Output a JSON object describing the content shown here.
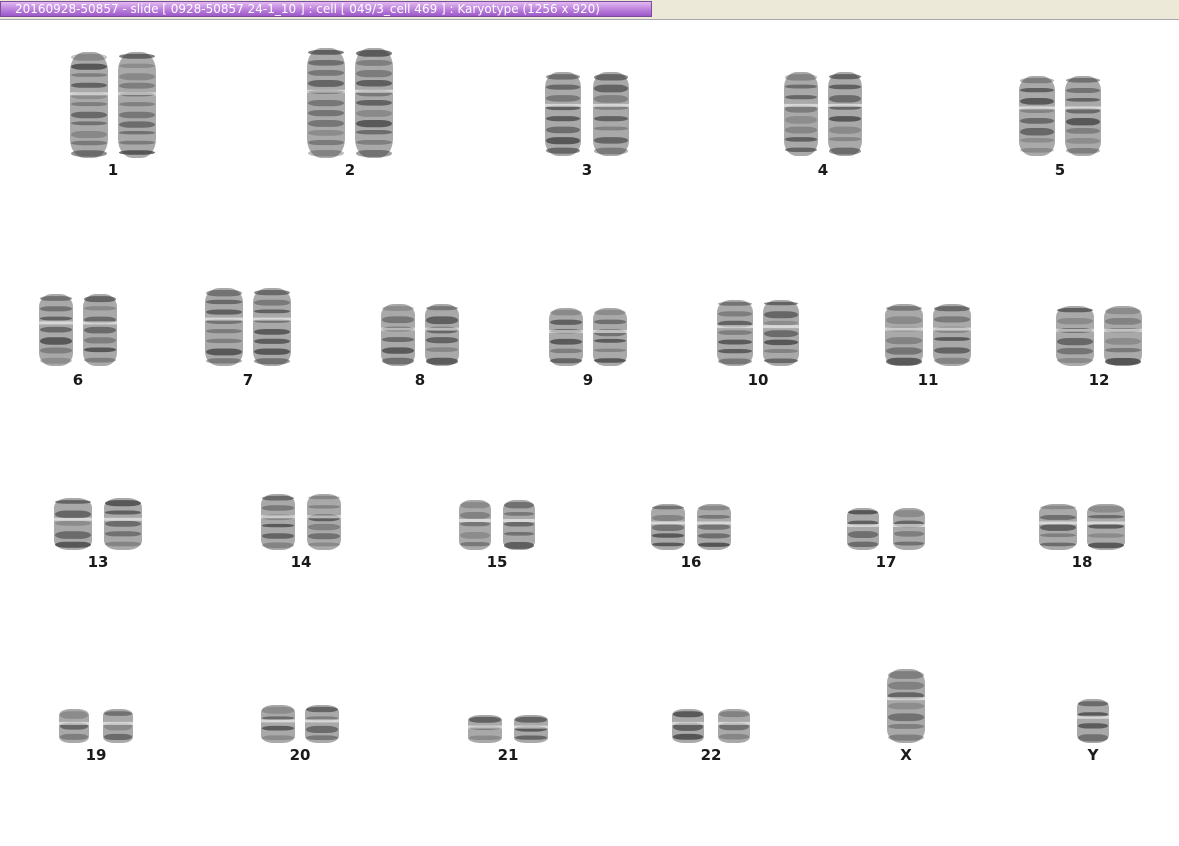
{
  "window": {
    "title": "20160928-50857 - slide [ 0928-50857 24-1_10 ] : cell [ 049/3_cell 469 ] : Karyotype  (1256 x 920)"
  },
  "karyotype": {
    "ink": "#3a3a3a",
    "rows": [
      [
        {
          "label": "1",
          "count": 2
        },
        {
          "label": "2",
          "count": 2
        },
        {
          "label": "3",
          "count": 2
        },
        {
          "label": "4",
          "count": 2
        },
        {
          "label": "5",
          "count": 2
        }
      ],
      [
        {
          "label": "6",
          "count": 2
        },
        {
          "label": "7",
          "count": 2
        },
        {
          "label": "8",
          "count": 2
        },
        {
          "label": "9",
          "count": 2
        },
        {
          "label": "10",
          "count": 2
        },
        {
          "label": "11",
          "count": 2
        },
        {
          "label": "12",
          "count": 2
        }
      ],
      [
        {
          "label": "13",
          "count": 2
        },
        {
          "label": "14",
          "count": 2
        },
        {
          "label": "15",
          "count": 2
        },
        {
          "label": "16",
          "count": 2
        },
        {
          "label": "17",
          "count": 2
        },
        {
          "label": "18",
          "count": 2
        }
      ],
      [
        {
          "label": "19",
          "count": 2
        },
        {
          "label": "20",
          "count": 2
        },
        {
          "label": "21",
          "count": 2
        },
        {
          "label": "22",
          "count": 2
        },
        {
          "label": "X",
          "count": 1
        },
        {
          "label": "Y",
          "count": 1
        }
      ]
    ]
  }
}
